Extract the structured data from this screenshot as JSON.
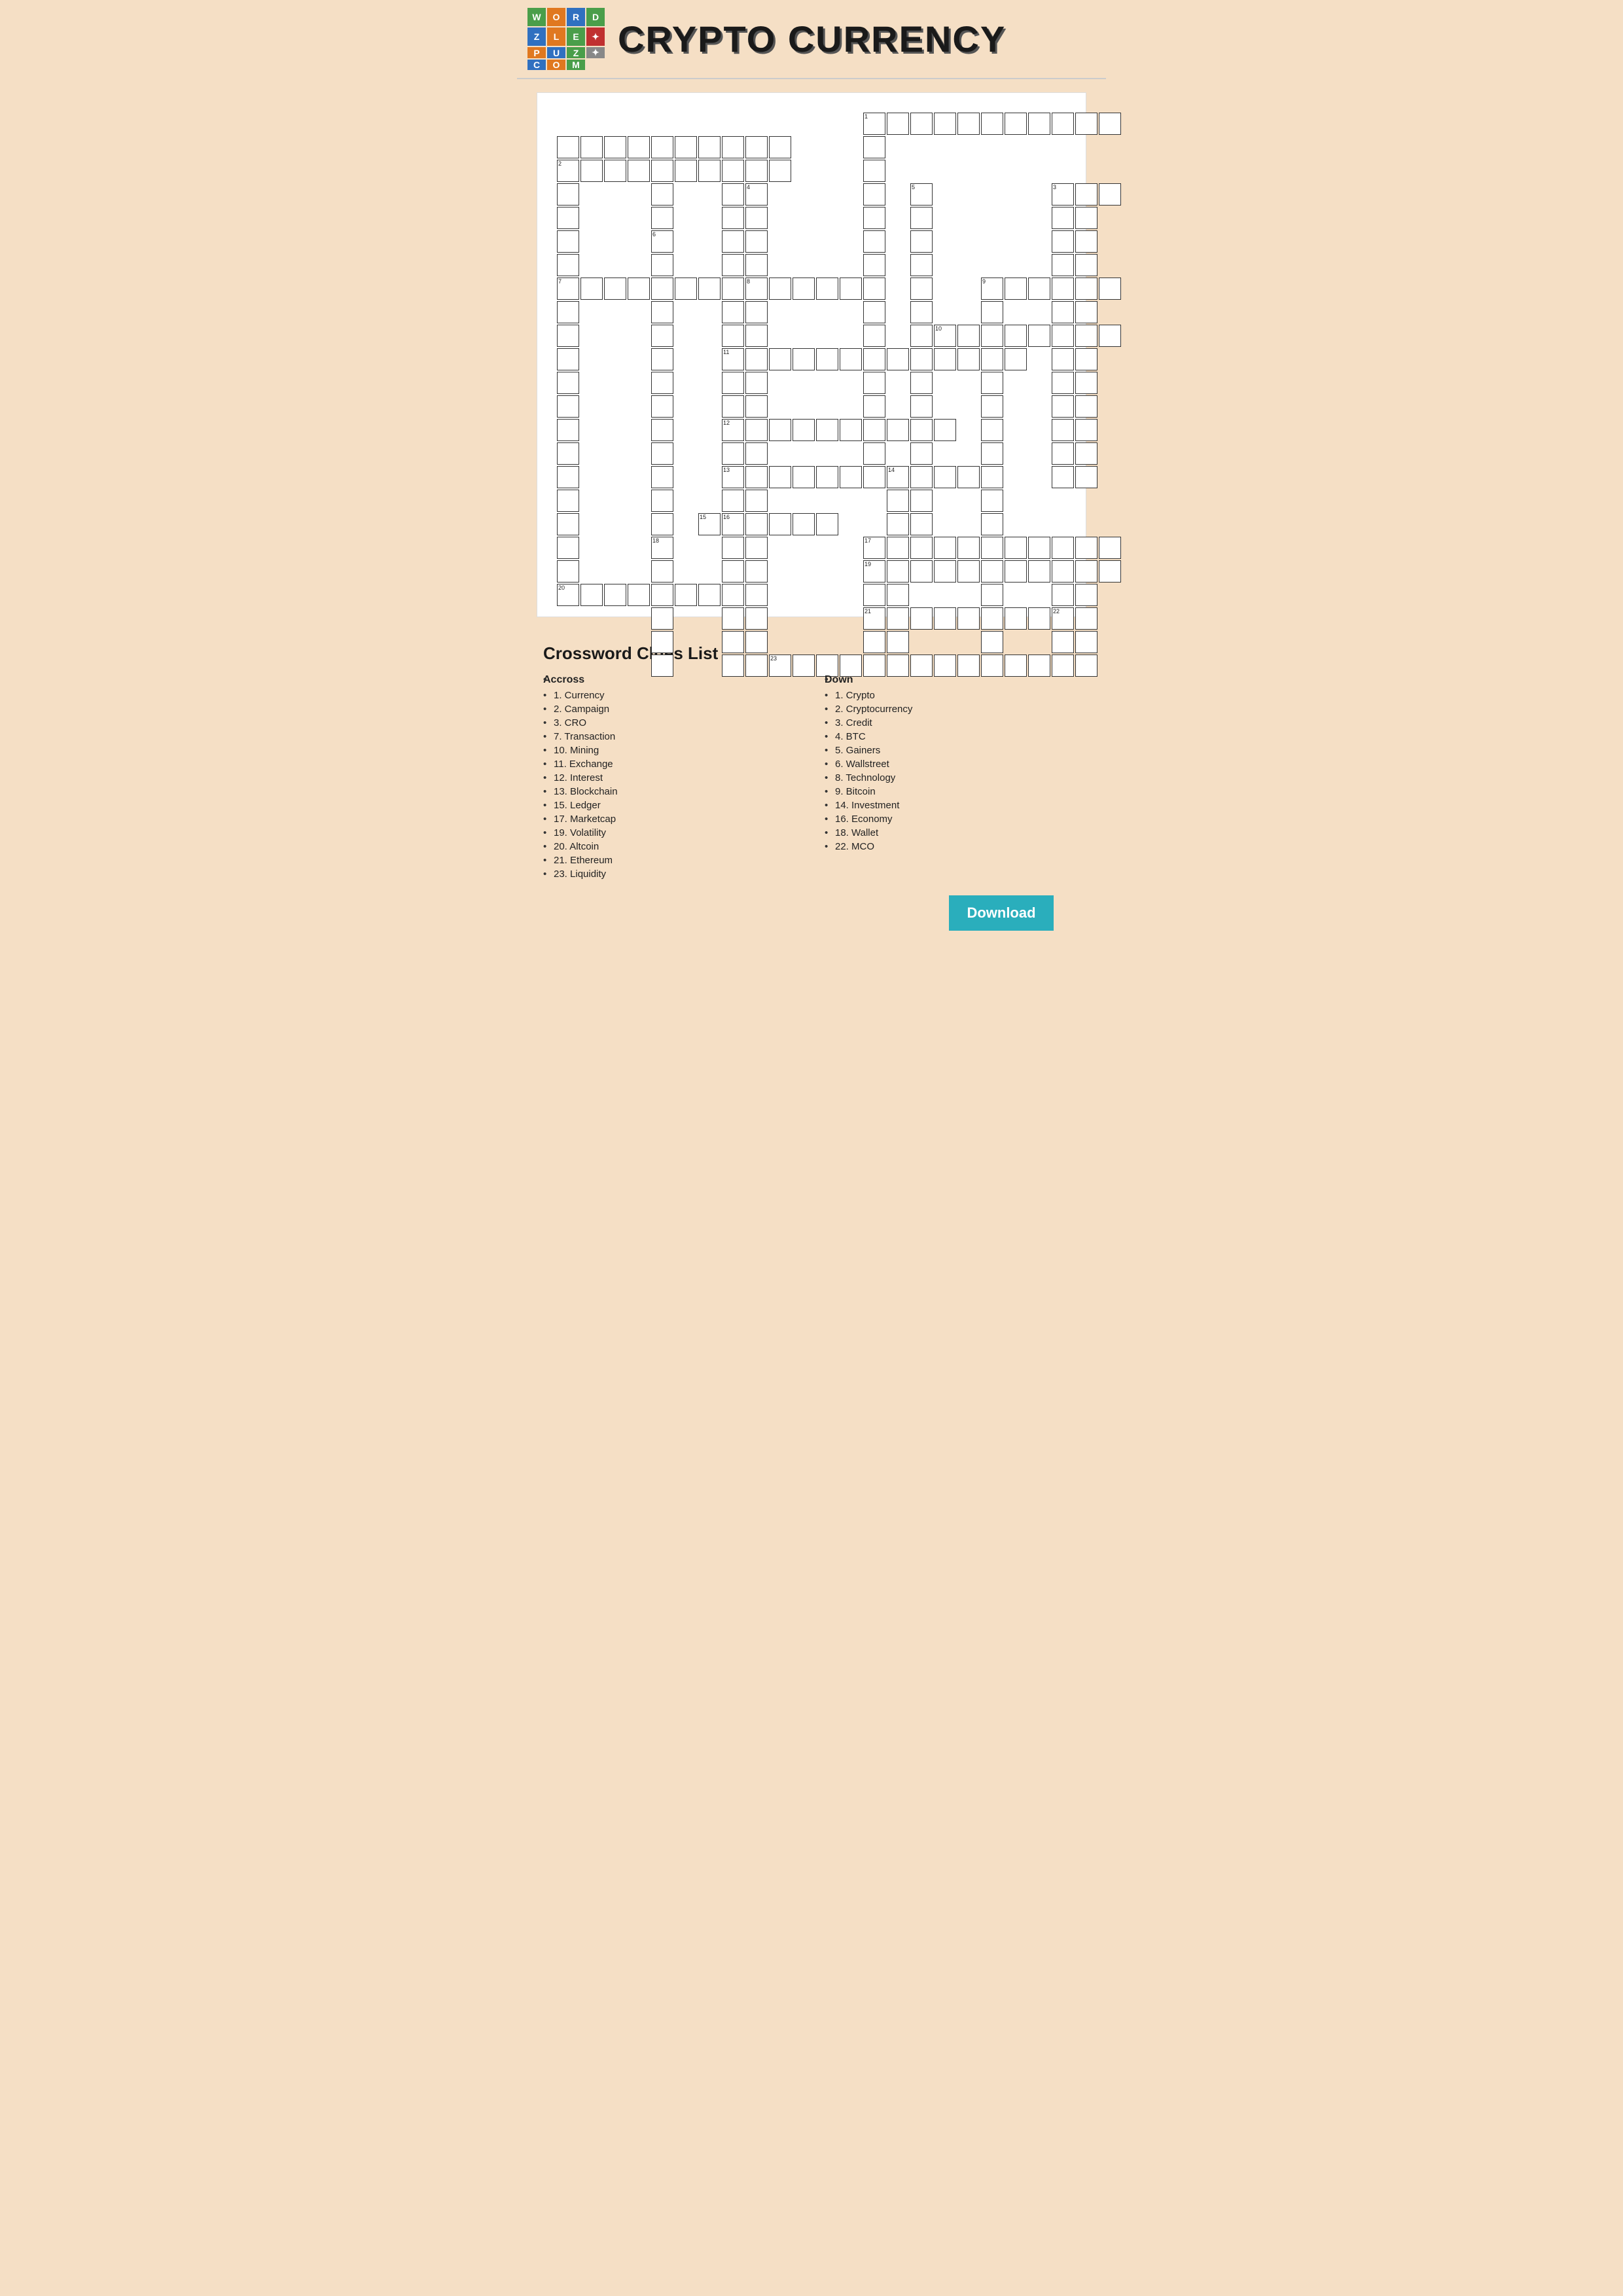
{
  "header": {
    "title": "CRYPTO CURRENCY",
    "logo_letters": [
      "W",
      "O",
      "R",
      "D",
      "Z",
      "L",
      "E",
      "•",
      "P",
      "U",
      "Z",
      "•",
      "C",
      "O",
      "M",
      "•"
    ]
  },
  "clues": {
    "title": "Crossword Clues List",
    "across_header": "Accross",
    "across": [
      "1. Currency",
      "2. Campaign",
      "3. CRO",
      "7. Transaction",
      "10. Mining",
      "11. Exchange",
      "12. Interest",
      "13. Blockchain",
      "15. Ledger",
      "17. Marketcap",
      "19. Volatility",
      "20. Altcoin",
      "21. Ethereum",
      "23. Liquidity"
    ],
    "down_header": "Down",
    "down": [
      "1. Crypto",
      "2. Cryptocurrency",
      "3. Credit",
      "4. BTC",
      "5. Gainers",
      "6. Wallstreet",
      "8. Technology",
      "9. Bitcoin",
      "14. Investment",
      "16. Economy",
      "18. Wallet",
      "22. MCO"
    ]
  },
  "download_label": "Download"
}
